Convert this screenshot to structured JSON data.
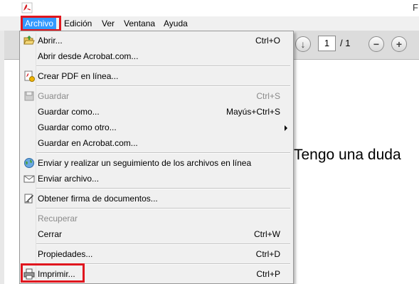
{
  "title_right": "F",
  "menubar": {
    "items": [
      {
        "label": "Archivo",
        "active": true
      },
      {
        "label": "Edición"
      },
      {
        "label": "Ver"
      },
      {
        "label": "Ventana"
      },
      {
        "label": "Ayuda"
      }
    ]
  },
  "toolbar": {
    "page_current": "1",
    "page_total": "/ 1"
  },
  "document": {
    "text": "Tengo una duda"
  },
  "file_menu": {
    "items": [
      {
        "label": "Abrir...",
        "shortcut": "Ctrl+O",
        "icon": "open-folder-icon"
      },
      {
        "label": "Abrir desde Acrobat.com...",
        "shortcut": ""
      },
      {
        "label": "Crear PDF en línea...",
        "shortcut": "",
        "icon": "create-pdf-icon"
      },
      {
        "label": "Guardar",
        "shortcut": "Ctrl+S",
        "icon": "save-disk-icon",
        "disabled": true
      },
      {
        "label": "Guardar como...",
        "shortcut": "Mayús+Ctrl+S"
      },
      {
        "label": "Guardar como otro...",
        "shortcut": "",
        "submenu": true
      },
      {
        "label": "Guardar en Acrobat.com...",
        "shortcut": ""
      },
      {
        "label": "Enviar y realizar un seguimiento de los archivos en línea",
        "shortcut": "",
        "icon": "globe-icon"
      },
      {
        "label": "Enviar archivo...",
        "shortcut": "",
        "icon": "envelope-icon"
      },
      {
        "label": "Obtener firma de documentos...",
        "shortcut": "",
        "icon": "sign-document-icon"
      },
      {
        "label": "Recuperar",
        "shortcut": "",
        "disabled": true
      },
      {
        "label": "Cerrar",
        "shortcut": "Ctrl+W"
      },
      {
        "label": "Propiedades...",
        "shortcut": "Ctrl+D"
      },
      {
        "label": "Imprimir...",
        "shortcut": "Ctrl+P",
        "icon": "printer-icon"
      }
    ]
  },
  "colors": {
    "highlight_box": "#e0161e",
    "menu_active_bg": "#3399ff"
  }
}
